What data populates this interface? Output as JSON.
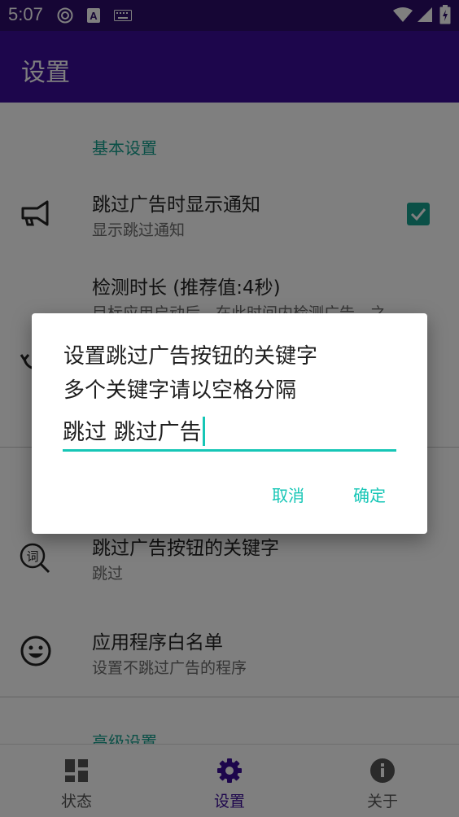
{
  "status_bar": {
    "time": "5:07",
    "icons": [
      "circle-app-icon",
      "a-notification-icon",
      "keyboard-icon",
      "wifi-icon",
      "cell-signal-icon",
      "battery-icon"
    ]
  },
  "app_bar": {
    "title": "设置"
  },
  "settings": {
    "category_basic": "基本设置",
    "items": [
      {
        "title": "跳过广告时显示通知",
        "summary": "显示跳过通知",
        "icon": "megaphone-icon",
        "checked": true
      },
      {
        "title": "检测时长 (推荐值:4秒)",
        "summary": "目标应用启动后，在此时间内检测广告，之",
        "icon": "refresh-icon"
      },
      {
        "title": "跳过广告按钮的关键字",
        "summary": "跳过",
        "icon": "word-search-icon"
      },
      {
        "title": "应用程序白名单",
        "summary": "设置不跳过广告的程序",
        "icon": "smiley-icon"
      }
    ],
    "category_advanced": "高级设置"
  },
  "bottom_nav": {
    "items": [
      {
        "label": "状态",
        "icon": "dashboard-icon",
        "active": false
      },
      {
        "label": "设置",
        "icon": "gear-icon",
        "active": true
      },
      {
        "label": "关于",
        "icon": "info-icon",
        "active": false
      }
    ]
  },
  "dialog": {
    "line1": "设置跳过广告按钮的关键字",
    "line2": "多个关键字请以空格分隔",
    "input_value": "跳过 跳过广告",
    "cancel": "取消",
    "ok": "确定"
  },
  "colors": {
    "status_bar": "#2c0c6a",
    "app_bar": "#3a0d99",
    "accent": "#16a08f",
    "input_accent": "#16c6b6"
  }
}
